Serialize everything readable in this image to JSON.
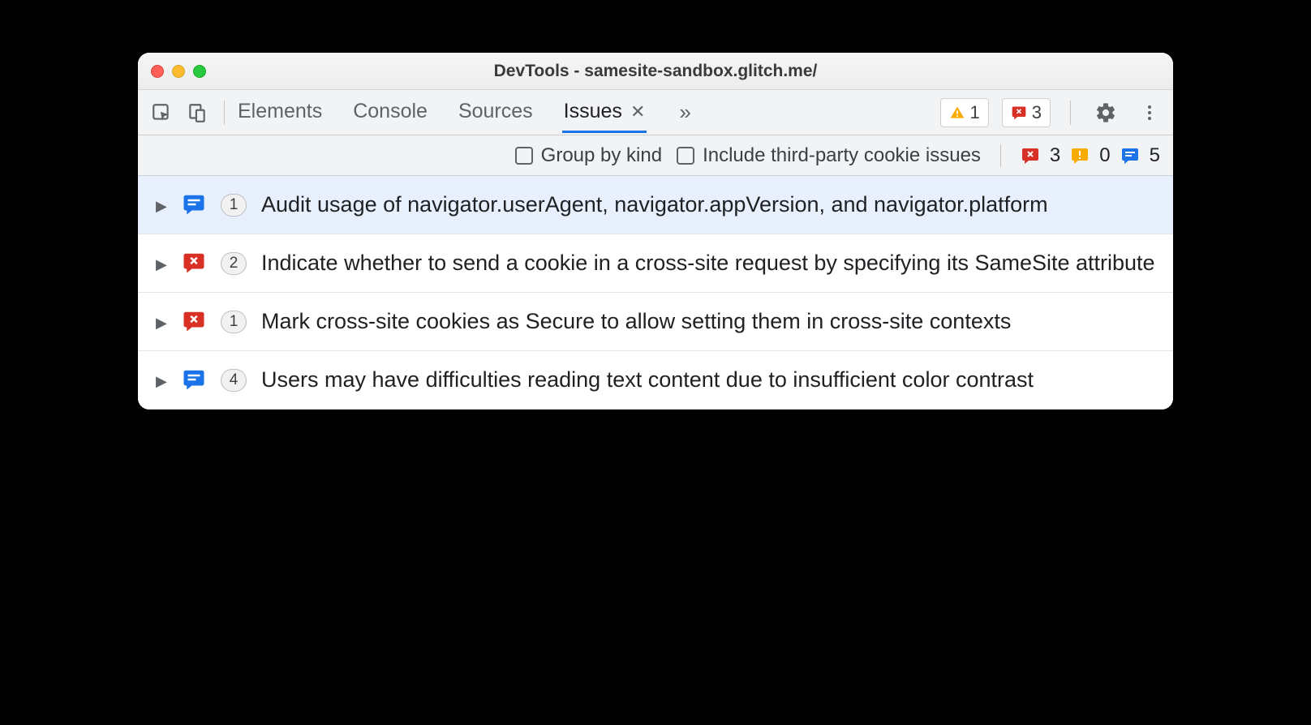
{
  "window": {
    "title": "DevTools - samesite-sandbox.glitch.me/"
  },
  "tabs": {
    "items": [
      {
        "label": "Elements",
        "active": false
      },
      {
        "label": "Console",
        "active": false
      },
      {
        "label": "Sources",
        "active": false
      },
      {
        "label": "Issues",
        "active": true,
        "closeable": true
      }
    ]
  },
  "toolbarBadges": {
    "warnings": "1",
    "errors": "3"
  },
  "filterbar": {
    "groupByKind": "Group by kind",
    "includeThirdParty": "Include third-party cookie issues",
    "counts": {
      "errors": "3",
      "warnings": "0",
      "info": "5"
    }
  },
  "issues": [
    {
      "category": "info",
      "count": "1",
      "selected": true,
      "title": "Audit usage of navigator.userAgent, navigator.appVersion, and navigator.platform"
    },
    {
      "category": "error",
      "count": "2",
      "selected": false,
      "title": "Indicate whether to send a cookie in a cross-site request by specifying its SameSite attribute"
    },
    {
      "category": "error",
      "count": "1",
      "selected": false,
      "title": "Mark cross-site cookies as Secure to allow setting them in cross-site contexts"
    },
    {
      "category": "info",
      "count": "4",
      "selected": false,
      "title": "Users may have difficulties reading text content due to insufficient color contrast"
    }
  ]
}
